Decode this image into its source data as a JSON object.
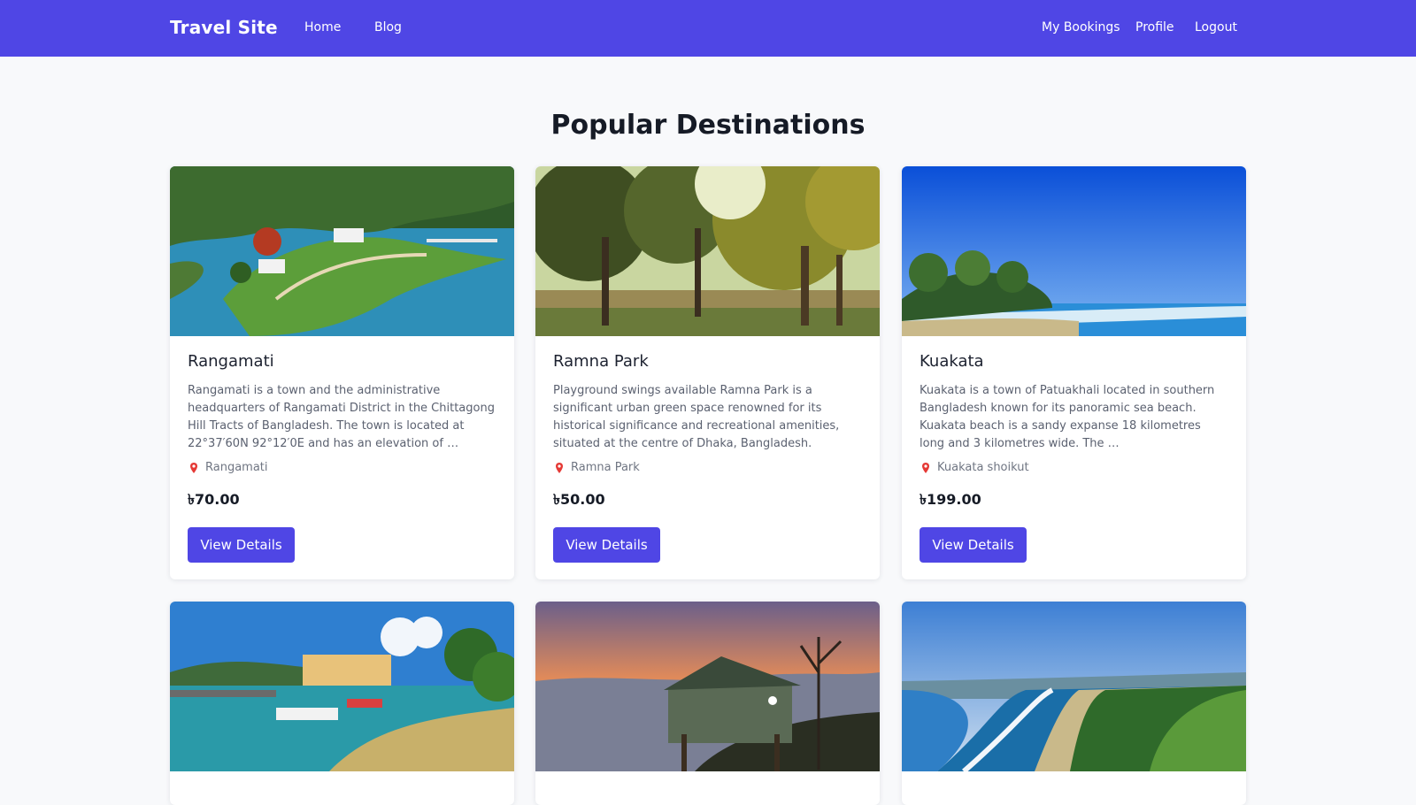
{
  "navbar": {
    "brand": "Travel Site",
    "links": [
      "Home",
      "Blog"
    ],
    "right_links": [
      "My Bookings",
      "Profile",
      "Logout"
    ],
    "background": "#4f46e5"
  },
  "page": {
    "title": "Popular Destinations"
  },
  "location_icon": "map-pin-icon",
  "button_label": "View Details",
  "accent_color": "#4f46e5",
  "pin_color": "#e53935",
  "destinations": [
    {
      "title": "Rangamati",
      "description": "Rangamati is a town and the administrative headquarters of Rangamati District in the Chittagong Hill Tracts of Bangladesh. The town is located at 22°37′60N 92°12′0E and has an elevation of …",
      "location": "Rangamati",
      "price": "৳70.00",
      "image": "lake-island-photo"
    },
    {
      "title": "Ramna Park",
      "description": "Playground swings available Ramna Park is a significant urban green space renowned for its historical significance and recreational amenities, situated at the centre of Dhaka, Bangladesh.",
      "location": "Ramna Park",
      "price": "৳50.00",
      "image": "park-trees-photo"
    },
    {
      "title": "Kuakata",
      "description": "Kuakata is a town of Patuakhali located in southern Bangladesh known for its panoramic sea beach. Kuakata beach is a sandy expanse 18 kilometres long and 3 kilometres wide. The …",
      "location": "Kuakata shoikut",
      "price": "৳199.00",
      "image": "beach-photo"
    },
    {
      "image": "harbor-boats-photo"
    },
    {
      "image": "hill-cottage-photo"
    },
    {
      "image": "coastline-aerial-photo"
    }
  ]
}
